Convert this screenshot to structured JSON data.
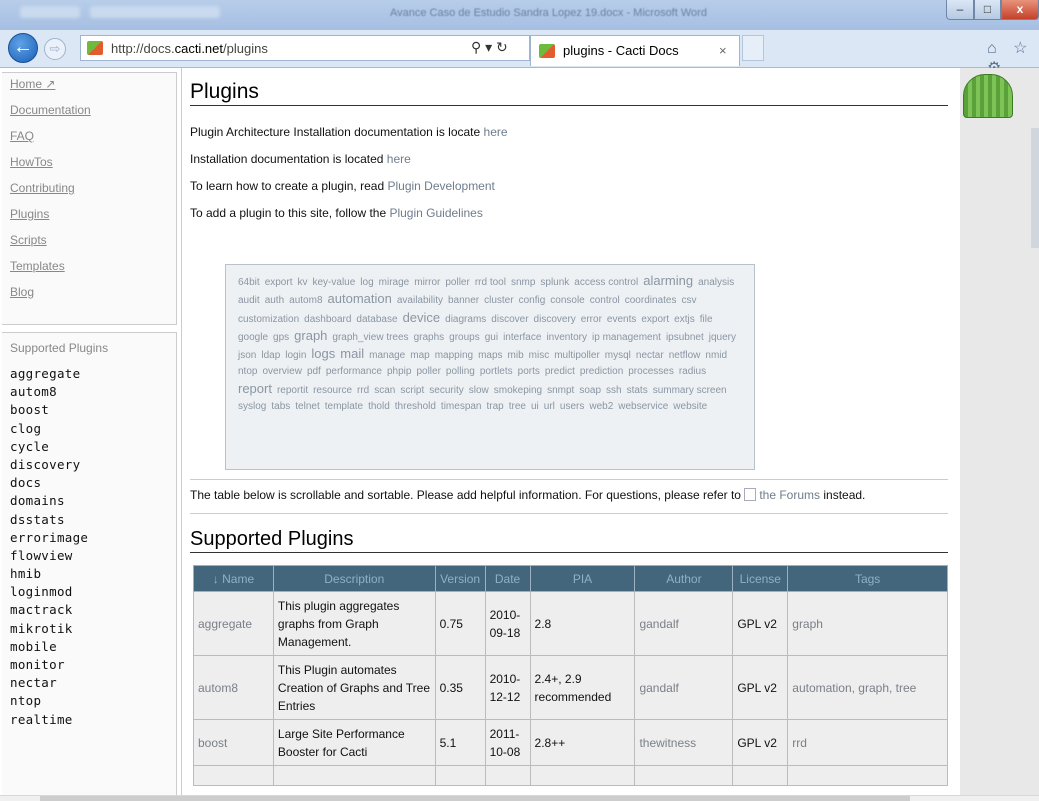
{
  "window": {
    "title": "Avance Caso de Estudio Sandra Lopez 19.docx - Microsoft Word",
    "minimize_glyph": "–",
    "maximize_glyph": "□",
    "close_glyph": "x"
  },
  "browser": {
    "back_glyph": "←",
    "forward_glyph": "⇨",
    "url_prefix": "http://docs.",
    "url_domain": "cacti.net",
    "url_suffix": "/plugins",
    "search_glyph": "⚲ ▾ ↻",
    "tab_title": "plugins - Cacti Docs",
    "tab_close": "×",
    "toolbar_icons": "⌂ ☆ ⚙"
  },
  "sidebar": {
    "nav": [
      "Home ↗",
      "Documentation",
      "FAQ",
      "HowTos",
      "Contributing",
      "Plugins",
      "Scripts",
      "Templates",
      "Blog"
    ],
    "plugins_heading": "Supported Plugins",
    "plugins": [
      "aggregate",
      "autom8",
      "boost",
      "clog",
      "cycle",
      "discovery",
      "docs",
      "domains",
      "dsstats",
      "errorimage",
      "flowview",
      "hmib",
      "loginmod",
      "mactrack",
      "mikrotik",
      "mobile",
      "monitor",
      "nectar",
      "ntop",
      "realtime"
    ]
  },
  "main": {
    "title": "Plugins",
    "lines": [
      {
        "text": "Plugin Architecture Installation documentation is locate ",
        "link": "here"
      },
      {
        "text": "Installation documentation is located ",
        "link": "here"
      },
      {
        "text": "To learn how to create a plugin, read ",
        "link": "Plugin Development"
      },
      {
        "text": "To add a plugin to this site, follow the ",
        "link": "Plugin Guidelines"
      }
    ],
    "tags": [
      [
        "64bit",
        0
      ],
      [
        "export",
        0
      ],
      [
        "kv",
        0
      ],
      [
        "key-value",
        0
      ],
      [
        "log",
        0
      ],
      [
        "mirage",
        0
      ],
      [
        "mirror",
        0
      ],
      [
        "poller",
        0
      ],
      [
        "rrd tool",
        0
      ],
      [
        "snmp",
        0
      ],
      [
        "splunk",
        0
      ],
      [
        "access control",
        0
      ],
      [
        "alarming",
        1
      ],
      [
        "analysis",
        0
      ],
      [
        "audit",
        0
      ],
      [
        "auth",
        0
      ],
      [
        "autom8",
        0
      ],
      [
        "automation",
        1
      ],
      [
        "availability",
        0
      ],
      [
        "banner",
        0
      ],
      [
        "cluster",
        0
      ],
      [
        "config",
        0
      ],
      [
        "console",
        0
      ],
      [
        "control",
        0
      ],
      [
        "coordinates",
        0
      ],
      [
        "csv",
        0
      ],
      [
        "customization",
        0
      ],
      [
        "dashboard",
        0
      ],
      [
        "database",
        0
      ],
      [
        "device",
        1
      ],
      [
        "diagrams",
        0
      ],
      [
        "discover",
        0
      ],
      [
        "discovery",
        0
      ],
      [
        "error",
        0
      ],
      [
        "events",
        0
      ],
      [
        "export",
        0
      ],
      [
        "extjs",
        0
      ],
      [
        "file",
        0
      ],
      [
        "google",
        0
      ],
      [
        "gps",
        0
      ],
      [
        "graph",
        1
      ],
      [
        "graph_view trees",
        0
      ],
      [
        "graphs",
        0
      ],
      [
        "groups",
        0
      ],
      [
        "gui",
        0
      ],
      [
        "interface",
        0
      ],
      [
        "inventory",
        0
      ],
      [
        "ip management",
        0
      ],
      [
        "ipsubnet",
        0
      ],
      [
        "jquery",
        0
      ],
      [
        "json",
        0
      ],
      [
        "ldap",
        0
      ],
      [
        "login",
        0
      ],
      [
        "logs",
        1
      ],
      [
        "mail",
        1
      ],
      [
        "manage",
        0
      ],
      [
        "map",
        0
      ],
      [
        "mapping",
        0
      ],
      [
        "maps",
        0
      ],
      [
        "mib",
        0
      ],
      [
        "misc",
        0
      ],
      [
        "multipoller",
        0
      ],
      [
        "mysql",
        0
      ],
      [
        "nectar",
        0
      ],
      [
        "netflow",
        0
      ],
      [
        "nmid",
        0
      ],
      [
        "ntop",
        0
      ],
      [
        "overview",
        0
      ],
      [
        "pdf",
        0
      ],
      [
        "performance",
        0
      ],
      [
        "phpip",
        0
      ],
      [
        "poller",
        0
      ],
      [
        "polling",
        0
      ],
      [
        "portlets",
        0
      ],
      [
        "ports",
        0
      ],
      [
        "predict",
        0
      ],
      [
        "prediction",
        0
      ],
      [
        "processes",
        0
      ],
      [
        "radius",
        0
      ],
      [
        "report",
        1
      ],
      [
        "reportit",
        0
      ],
      [
        "resource",
        0
      ],
      [
        "rrd",
        0
      ],
      [
        "scan",
        0
      ],
      [
        "script",
        0
      ],
      [
        "security",
        0
      ],
      [
        "slow",
        0
      ],
      [
        "smokeping",
        0
      ],
      [
        "snmpt",
        0
      ],
      [
        "soap",
        0
      ],
      [
        "ssh",
        0
      ],
      [
        "stats",
        0
      ],
      [
        "summary screen",
        0
      ],
      [
        "syslog",
        0
      ],
      [
        "tabs",
        0
      ],
      [
        "telnet",
        0
      ],
      [
        "template",
        0
      ],
      [
        "thold",
        0
      ],
      [
        "threshold",
        0
      ],
      [
        "timespan",
        0
      ],
      [
        "trap",
        0
      ],
      [
        "tree",
        0
      ],
      [
        "ui",
        0
      ],
      [
        "url",
        0
      ],
      [
        "users",
        0
      ],
      [
        "web2",
        0
      ],
      [
        "webservice",
        0
      ],
      [
        "website",
        0
      ]
    ],
    "scroll_note_before": "The table below is scrollable and sortable. Please add helpful information. For questions, please refer to ",
    "scroll_note_link": "the Forums",
    "scroll_note_after": " instead.",
    "supported_title": "Supported Plugins"
  },
  "table": {
    "headers": [
      "↓ Name",
      "Description",
      "Version",
      "Date",
      "PIA",
      "Author",
      "License",
      "Tags"
    ],
    "rows": [
      [
        "aggregate",
        "This plugin aggregates graphs from Graph Management.",
        "0.75",
        "2010-09-18",
        "2.8",
        "gandalf",
        "GPL v2",
        "graph"
      ],
      [
        "autom8",
        "This Plugin automates Creation of Graphs and Tree Entries",
        "0.35",
        "2010-12-12",
        "2.4+, 2.9 recommended",
        "gandalf",
        "GPL v2",
        "automation, graph, tree"
      ],
      [
        "boost",
        "Large Site Performance Booster for Cacti",
        "5.1",
        "2011-10-08",
        "2.8++",
        "thewitness",
        "GPL v2",
        "rrd"
      ]
    ]
  },
  "colors": {
    "table_header_bg": "#44667c",
    "link": "#6f7c8c",
    "titlebar": "#b7cde9"
  }
}
